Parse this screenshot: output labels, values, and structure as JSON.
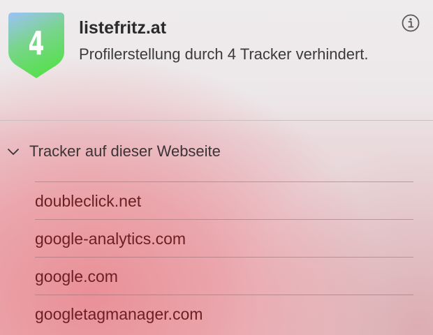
{
  "header": {
    "tracker_count": "4",
    "site_name": "listefritz.at",
    "subtitle": "Profilerstellung durch 4 Tracker verhindert.",
    "info_icon": "info-circle-icon"
  },
  "trackers_section": {
    "label": "Tracker auf dieser Webseite",
    "expanded": true,
    "chevron_icon": "chevron-down-icon",
    "items": [
      {
        "domain": "doubleclick.net"
      },
      {
        "domain": "google-analytics.com"
      },
      {
        "domain": "google.com"
      },
      {
        "domain": "googletagmanager.com"
      }
    ]
  },
  "colors": {
    "shield_gradient_top": "#8fc9e6",
    "shield_gradient_bottom": "#5ede52",
    "tracker_text": "#6b1f22",
    "background_accent": "#ea8c94"
  }
}
